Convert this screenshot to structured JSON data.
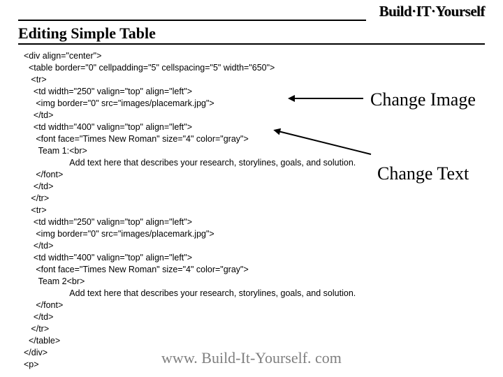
{
  "logo_text": "Build·IT·Yourself",
  "title": "Editing Simple Table",
  "annotations": {
    "change_image": "Change Image",
    "change_text": "Change Text"
  },
  "footer": "www. Build-It-Yourself. com",
  "code_lines": [
    "<div align=\"center\">",
    "  <table border=\"0\" cellpadding=\"5\" cellspacing=\"5\" width=\"650\">",
    "   <tr>",
    "    <td width=\"250\" valign=\"top\" align=\"left\">",
    "     <img border=\"0\" src=\"images/placemark.jpg\">",
    "    </td>",
    "    <td width=\"400\" valign=\"top\" align=\"left\">",
    "     <font face=\"Times New Roman\" size=\"4\" color=\"gray\">",
    "      Team 1:<br>",
    "                   Add text here that describes your research, storylines, goals, and solution.",
    "     </font>",
    "    </td>",
    "   </tr>",
    "   <tr>",
    "    <td width=\"250\" valign=\"top\" align=\"left\">",
    "     <img border=\"0\" src=\"images/placemark.jpg\">",
    "    </td>",
    "    <td width=\"400\" valign=\"top\" align=\"left\">",
    "     <font face=\"Times New Roman\" size=\"4\" color=\"gray\">",
    "      Team 2<br>",
    "                   Add text here that describes your research, storylines, goals, and solution.",
    "     </font>",
    "    </td>",
    "   </tr>",
    "  </table>",
    "</div>",
    "<p>"
  ]
}
